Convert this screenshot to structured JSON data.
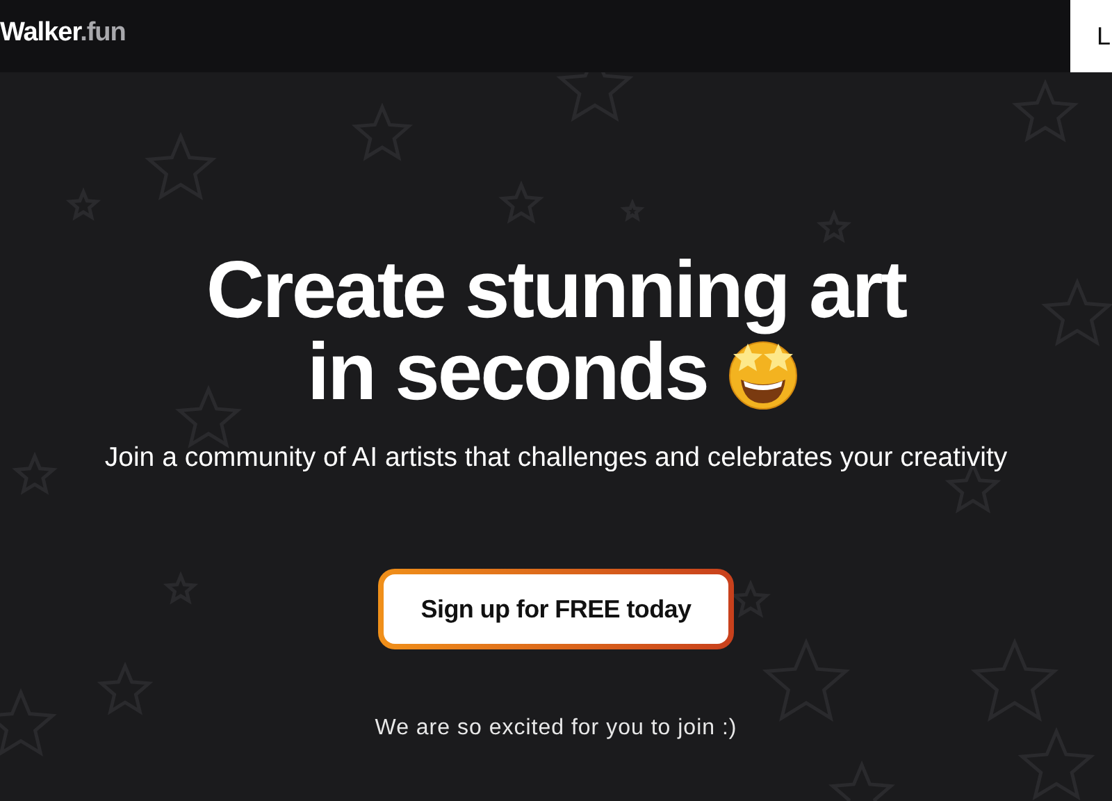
{
  "header": {
    "logo": {
      "name": "Walker",
      "suffix": ".fun"
    },
    "login_button": "L"
  },
  "hero": {
    "title_lines": [
      "Create stunning art",
      "in seconds"
    ],
    "subtitle": "Join a community of AI artists that challenges and celebrates your creativity",
    "cta": "Sign up for FREE today",
    "note": "We are so excited for you to join :)"
  }
}
